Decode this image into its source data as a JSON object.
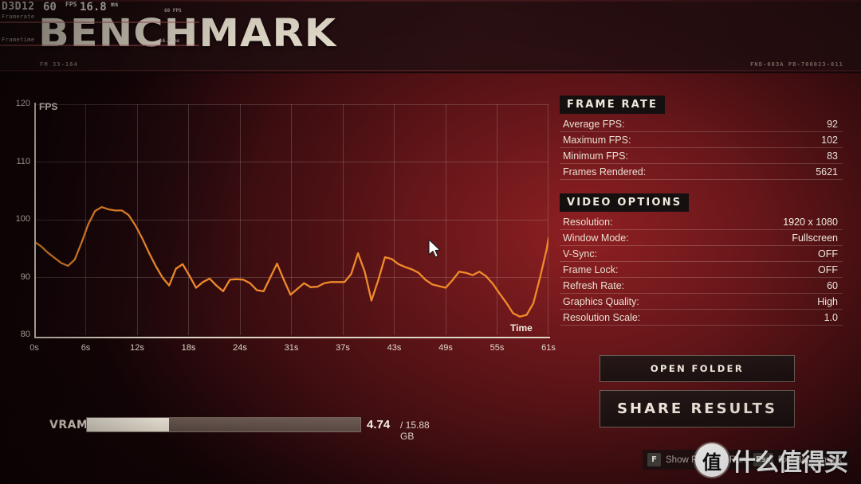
{
  "header": {
    "title": "BENCHMARK",
    "code_left": "FM 33-164",
    "code_right": "FND-003A PB-700023-011"
  },
  "perf_overlay": {
    "api": "D3D12",
    "fps_value": "60",
    "fps_unit": "FPS",
    "frametime_value": "16.8",
    "frametime_unit": "ms",
    "framerate_label": "Framerate",
    "frametime_label": "Frametime",
    "mini_fps_label": "60 FPS",
    "mini_ms_label": "16.8 ms"
  },
  "chart_data": {
    "type": "line",
    "title": "",
    "xlabel": "Time",
    "ylabel": "FPS",
    "ylim": [
      80,
      120
    ],
    "yticks": [
      80,
      90,
      100,
      110,
      120
    ],
    "xticks": [
      "0s",
      "6s",
      "12s",
      "18s",
      "24s",
      "31s",
      "37s",
      "43s",
      "49s",
      "55s",
      "61s"
    ],
    "xlim": [
      0,
      61
    ],
    "grid": true,
    "legend": "none",
    "line_color": "#f08a2a",
    "series": [
      {
        "name": "FPS",
        "x": [
          0,
          0.8,
          1.6,
          2.4,
          3.2,
          4.0,
          4.8,
          5.6,
          6.4,
          7.2,
          8.0,
          8.8,
          9.6,
          10.4,
          11.2,
          12.0,
          12.8,
          13.6,
          14.4,
          15.2,
          16.0,
          16.8,
          17.6,
          18.4,
          19.2,
          20.0,
          20.8,
          21.6,
          22.4,
          23.2,
          24.0,
          24.8,
          25.6,
          26.4,
          27.2,
          28.0,
          28.8,
          29.6,
          30.4,
          31.2,
          32.0,
          32.8,
          33.6,
          34.4,
          35.2,
          36.0,
          36.8,
          37.6,
          38.4,
          39.2,
          40.0,
          40.8,
          41.6,
          42.4,
          43.2,
          44.0,
          44.8,
          45.6,
          46.4,
          47.2,
          48.0,
          48.8,
          49.6,
          50.4,
          51.2,
          52.0,
          52.8,
          53.6,
          54.4,
          55.2,
          56.0,
          56.8,
          57.6,
          58.4,
          59.2,
          60.0,
          60.8,
          61.0
        ],
        "values": [
          96.2,
          95.4,
          94.3,
          93.4,
          92.5,
          92.0,
          93.1,
          96.0,
          99.2,
          101.5,
          102.2,
          101.8,
          101.6,
          101.6,
          100.8,
          99.0,
          96.8,
          94.3,
          92.0,
          90.0,
          88.6,
          91.5,
          92.3,
          90.3,
          88.2,
          89.2,
          89.8,
          88.6,
          87.6,
          89.6,
          89.7,
          89.6,
          89.0,
          87.8,
          87.6,
          90.0,
          92.4,
          89.6,
          87.0,
          88.0,
          89.0,
          88.3,
          88.4,
          89.0,
          89.2,
          89.2,
          89.2,
          90.6,
          94.2,
          91.0,
          86.0,
          89.5,
          93.5,
          93.2,
          92.3,
          91.8,
          91.4,
          90.8,
          89.6,
          88.8,
          88.5,
          88.2,
          89.5,
          91.0,
          90.8,
          90.4,
          91.0,
          90.2,
          88.9,
          87.2,
          85.6,
          83.8,
          83.2,
          83.5,
          85.5,
          90.0,
          95.0,
          96.8
        ]
      }
    ]
  },
  "vram": {
    "label": "VRAM",
    "used": "4.74",
    "total": "/ 15.88 GB",
    "fill_percent": 29.9
  },
  "stats": {
    "frame_rate": {
      "heading": "FRAME RATE",
      "rows": [
        {
          "key": "Average FPS:",
          "value": "92"
        },
        {
          "key": "Maximum FPS:",
          "value": "102"
        },
        {
          "key": "Minimum FPS:",
          "value": "83"
        },
        {
          "key": "Frames Rendered:",
          "value": "5621"
        }
      ]
    },
    "video_options": {
      "heading": "VIDEO OPTIONS",
      "rows": [
        {
          "key": "Resolution:",
          "value": "1920 x 1080"
        },
        {
          "key": "Window Mode:",
          "value": "Fullscreen"
        },
        {
          "key": "V-Sync:",
          "value": "OFF"
        },
        {
          "key": "Frame Lock:",
          "value": "OFF"
        },
        {
          "key": "Refresh Rate:",
          "value": "60"
        },
        {
          "key": "Graphics Quality:",
          "value": "High"
        },
        {
          "key": "Resolution Scale:",
          "value": "1.0"
        }
      ]
    }
  },
  "buttons": {
    "open_folder": "OPEN FOLDER",
    "share_results": "SHARE RESULTS"
  },
  "footer_hints": [
    {
      "key": "F",
      "text": "Show Previous Run"
    },
    {
      "key": "Esc",
      "text": "Exit Benchmark"
    }
  ],
  "watermark": {
    "badge": "值",
    "text": "什么值得买"
  },
  "colors": {
    "accent_line": "#f08a2a",
    "cream": "#efe7da",
    "panel_dark": "#15100f",
    "background_red": "#7a1b1e"
  }
}
